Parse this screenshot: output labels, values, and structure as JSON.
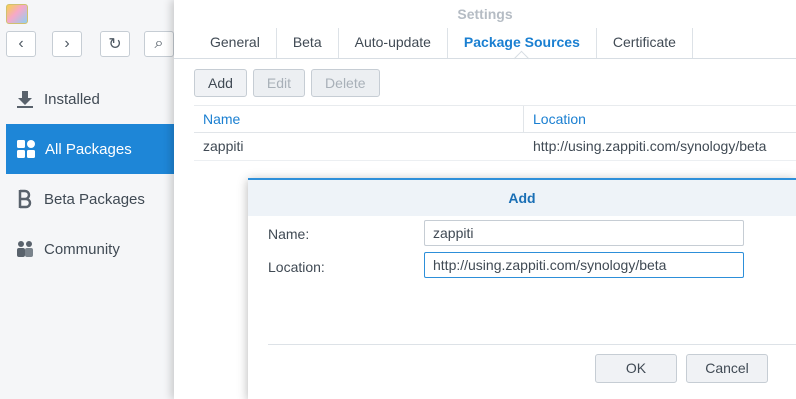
{
  "package_center": {
    "nav": {
      "back_icon": "chevron-left-icon",
      "forward_icon": "chevron-right-icon",
      "refresh_icon": "refresh-icon",
      "search_icon": "search-icon"
    },
    "sidebar": {
      "items": [
        {
          "label": "Installed",
          "icon": "download-icon",
          "active": false
        },
        {
          "label": "All Packages",
          "icon": "grid-icon",
          "active": true
        },
        {
          "label": "Beta Packages",
          "icon": "beta-icon",
          "active": false
        },
        {
          "label": "Community",
          "icon": "people-icon",
          "active": false
        }
      ]
    }
  },
  "settings": {
    "title": "Settings",
    "tabs": [
      {
        "label": "General"
      },
      {
        "label": "Beta"
      },
      {
        "label": "Auto-update"
      },
      {
        "label": "Package Sources",
        "active": true
      },
      {
        "label": "Certificate"
      }
    ],
    "toolbar": {
      "add": "Add",
      "edit": "Edit",
      "delete": "Delete"
    },
    "table": {
      "columns": [
        "Name",
        "Location"
      ],
      "rows": [
        {
          "name": "zappiti",
          "location": "http://using.zappiti.com/synology/beta"
        }
      ]
    }
  },
  "add_dialog": {
    "title": "Add",
    "name_label": "Name:",
    "name_value": "zappiti",
    "location_label": "Location:",
    "location_value": "http://using.zappiti.com/synology/beta",
    "ok": "OK",
    "cancel": "Cancel"
  },
  "colors": {
    "accent": "#1e86d7",
    "link_blue": "#1a7fd1"
  }
}
